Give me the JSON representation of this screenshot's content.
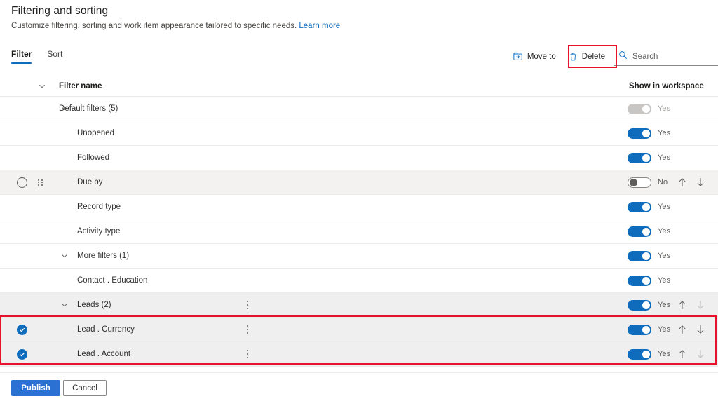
{
  "header": {
    "title": "Filtering and sorting",
    "subtitle": "Customize filtering, sorting and work item appearance tailored to specific needs.",
    "learn_more": "Learn more"
  },
  "tabs": [
    {
      "label": "Filter",
      "active": true
    },
    {
      "label": "Sort",
      "active": false
    }
  ],
  "toolbar": {
    "move_to_label": "Move to",
    "delete_label": "Delete",
    "search_placeholder": "Search",
    "search_value": "",
    "move_to_icon": "move-to-folder-icon",
    "delete_icon": "trash-icon",
    "search_icon": "search-icon"
  },
  "columns": {
    "filter_name": "Filter name",
    "show_in_workspace": "Show in workspace"
  },
  "rows": [
    {
      "name": "Default filters (5)",
      "indent": 84,
      "chevron": 84,
      "group": true,
      "toggle": "on-disabled",
      "toggle_label": "Yes",
      "toggle_label_dim": true,
      "arrows": false,
      "more": false,
      "state": "normal",
      "checkbox": "none"
    },
    {
      "name": "Unopened",
      "indent": 110,
      "chevron": null,
      "group": false,
      "toggle": "on",
      "toggle_label": "Yes",
      "toggle_label_dim": false,
      "arrows": false,
      "more": false,
      "state": "normal",
      "checkbox": "none"
    },
    {
      "name": "Followed",
      "indent": 110,
      "chevron": null,
      "group": false,
      "toggle": "on",
      "toggle_label": "Yes",
      "toggle_label_dim": false,
      "arrows": false,
      "more": false,
      "state": "normal",
      "checkbox": "none"
    },
    {
      "name": "Due by",
      "indent": 110,
      "chevron": null,
      "group": false,
      "toggle": "off",
      "toggle_label": "No",
      "toggle_label_dim": false,
      "arrows": true,
      "arrow_up_dim": false,
      "arrow_down_dim": false,
      "more": false,
      "state": "hover",
      "checkbox": "empty",
      "drag_handle": true
    },
    {
      "name": "Record type",
      "indent": 110,
      "chevron": null,
      "group": false,
      "toggle": "on",
      "toggle_label": "Yes",
      "toggle_label_dim": false,
      "arrows": false,
      "more": false,
      "state": "normal",
      "checkbox": "none"
    },
    {
      "name": "Activity type",
      "indent": 110,
      "chevron": null,
      "group": false,
      "toggle": "on",
      "toggle_label": "Yes",
      "toggle_label_dim": false,
      "arrows": false,
      "more": false,
      "state": "normal",
      "checkbox": "none"
    },
    {
      "name": "More filters (1)",
      "indent": 110,
      "chevron": 84,
      "group": true,
      "toggle": "on",
      "toggle_label": "Yes",
      "toggle_label_dim": false,
      "arrows": false,
      "more": false,
      "state": "normal",
      "checkbox": "none"
    },
    {
      "name": "Contact . Education",
      "indent": 110,
      "chevron": null,
      "group": false,
      "toggle": "on",
      "toggle_label": "Yes",
      "toggle_label_dim": false,
      "arrows": false,
      "more": false,
      "state": "normal",
      "checkbox": "none"
    },
    {
      "name": "Leads (2)",
      "indent": 110,
      "chevron": 84,
      "group": true,
      "toggle": "on",
      "toggle_label": "Yes",
      "toggle_label_dim": false,
      "arrows": true,
      "arrow_up_dim": false,
      "arrow_down_dim": true,
      "more": true,
      "state": "group-selected",
      "checkbox": "none"
    },
    {
      "name": "Lead . Currency",
      "indent": 110,
      "chevron": null,
      "group": false,
      "toggle": "on",
      "toggle_label": "Yes",
      "toggle_label_dim": false,
      "arrows": true,
      "arrow_up_dim": false,
      "arrow_down_dim": false,
      "more": true,
      "state": "selected",
      "checkbox": "checked"
    },
    {
      "name": "Lead . Account",
      "indent": 110,
      "chevron": null,
      "group": false,
      "toggle": "on",
      "toggle_label": "Yes",
      "toggle_label_dim": false,
      "arrows": true,
      "arrow_up_dim": false,
      "arrow_down_dim": true,
      "more": true,
      "state": "selected",
      "checkbox": "checked"
    }
  ],
  "footer": {
    "publish_label": "Publish",
    "cancel_label": "Cancel"
  },
  "colors": {
    "accent": "#0f6cbd",
    "primary_button": "#2b70d3",
    "highlight_red": "#e8112d",
    "link": "#0f6cbd",
    "row_hover": "#f3f2f1",
    "row_selected": "#efefef"
  }
}
